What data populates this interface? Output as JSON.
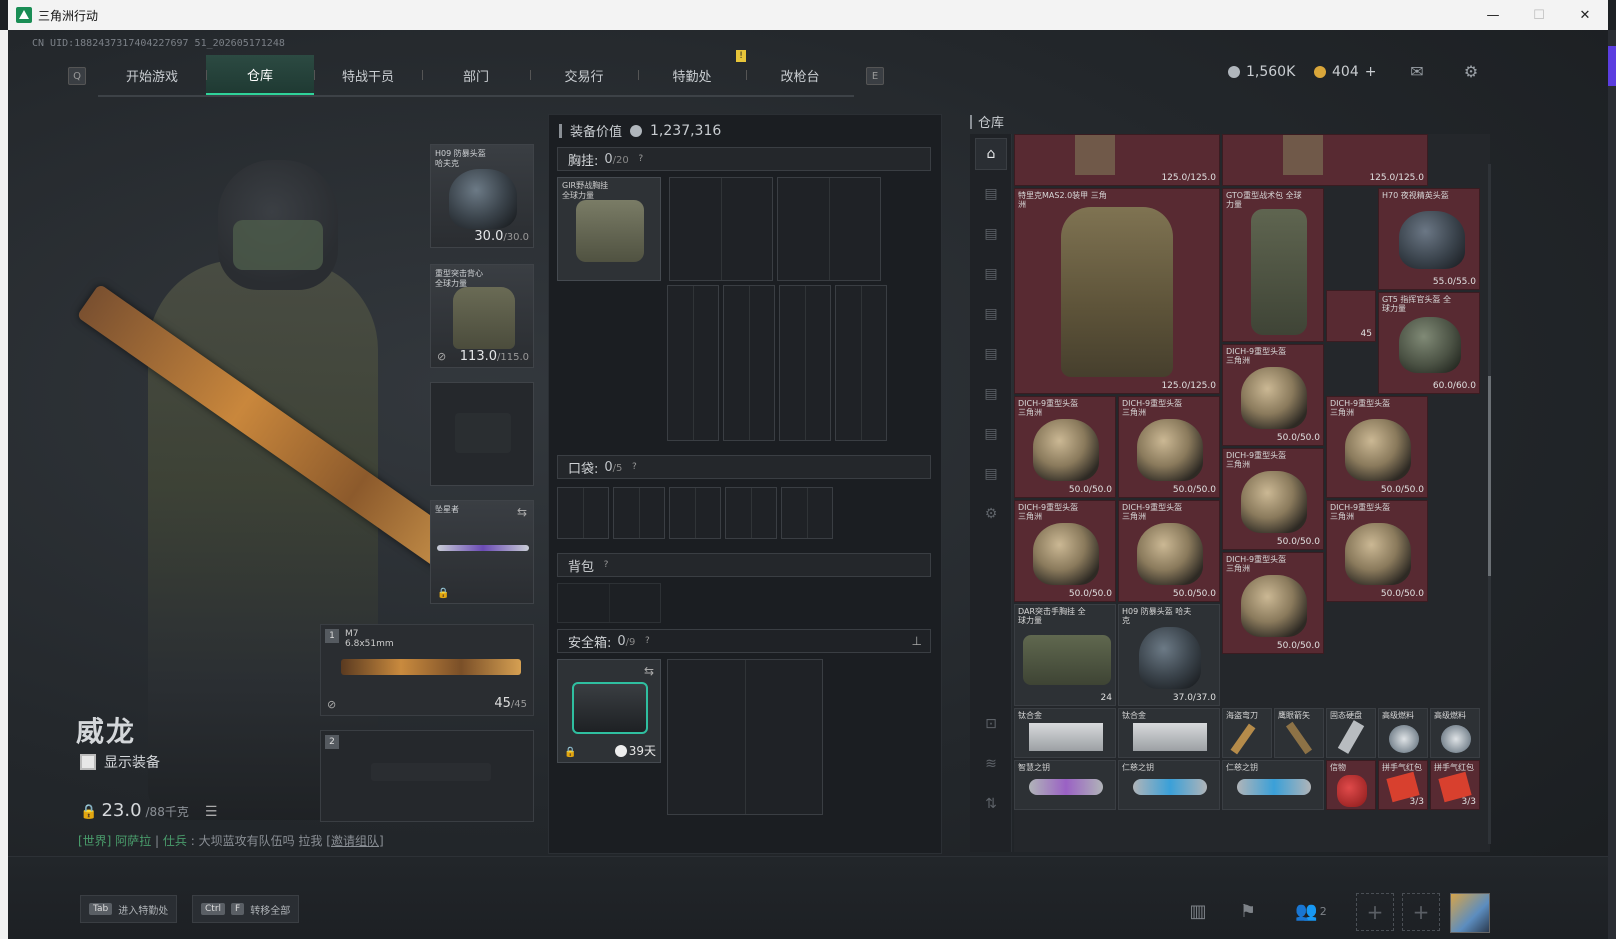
{
  "window": {
    "title": "三角洲行动",
    "min_label": "—",
    "max_label": "☐",
    "close_label": "✕"
  },
  "uid": "CN UID:1882437317404227697 51_202605171248",
  "nav": {
    "left_key": "Q",
    "right_key": "E",
    "tabs": [
      {
        "label": "开始游戏"
      },
      {
        "label": "仓库"
      },
      {
        "label": "特战干员"
      },
      {
        "label": "部门"
      },
      {
        "label": "交易行"
      },
      {
        "label": "特勤处"
      },
      {
        "label": "改枪台"
      }
    ],
    "active_tab": "仓库",
    "notice_badge": "!"
  },
  "currency": {
    "coins": "1,560K",
    "premium": "404",
    "add_label": "+"
  },
  "player": {
    "name": "威龙",
    "show_gear_label": "显示装备",
    "weight_value": "23.0",
    "weight_max": "/88千克"
  },
  "chat": {
    "channel": "[世界]",
    "sender": "阿萨拉",
    "role": "仕兵",
    "message": "大坝蓝攻有队伍吗  拉我",
    "link": "[邀请组队]"
  },
  "equipment": {
    "helmet": {
      "name": "H09 防暴头盔",
      "maker": "哈夫克",
      "durability": "30.0",
      "max": "/30.0"
    },
    "armor": {
      "name": "重型突击背心",
      "maker": "全球力量",
      "durability": "113.0",
      "max": "/115.0"
    },
    "melee": {
      "name": "坠星者"
    },
    "primary": {
      "slot": "1",
      "name": "M7",
      "caliber": "6.8x51mm",
      "ammo": "45",
      "ammo_max": "/45"
    },
    "secondary": {
      "slot": "2"
    }
  },
  "mid": {
    "equip_value_label": "装备价值",
    "equip_value": "1,237,316",
    "rig": {
      "label": "胸挂:",
      "count": "0",
      "cap": "/20",
      "item_name": "GIR野战胸挂",
      "item_maker": "全球力量"
    },
    "pocket": {
      "label": "口袋:",
      "count": "0",
      "cap": "/5"
    },
    "backpack": {
      "label": "背包"
    },
    "safebox": {
      "label": "安全箱:",
      "count": "0",
      "cap": "/9",
      "timer": "39天"
    },
    "help": "?",
    "pin": "📌"
  },
  "warehouse": {
    "title": "仓库",
    "items": [
      {
        "label": "",
        "dur": "125.0/125.0"
      },
      {
        "label": "",
        "dur": "125.0/125.0"
      },
      {
        "label": "特里克MAS2.0装甲 三角洲",
        "dur": "125.0/125.0"
      },
      {
        "label": "GTO重型战术包 全球力量",
        "dur": ""
      },
      {
        "label": "H70 夜视精英头盔",
        "dur": "55.0/55.0"
      },
      {
        "label": "GT5 指挥官头盔 全球力量",
        "dur": "60.0/60.0"
      },
      {
        "label": "DICH-9重型头盔 三角洲",
        "dur": "50.0/50.0"
      },
      {
        "label": "DICH-9重型头盔 三角洲",
        "dur": "50.0/50.0"
      },
      {
        "label": "DICH-9重型头盔 三角洲",
        "dur": "50.0/50.0"
      },
      {
        "label": "DICH-9重型头盔 三角洲",
        "dur": "50.0/50.0"
      },
      {
        "label": "DICH-9重型头盔 三角洲",
        "dur": "50.0/50.0"
      },
      {
        "label": "DICH-9重型头盔 三角洲",
        "dur": "50.0/50.0"
      },
      {
        "label": "DICH-9重型头盔 三角洲",
        "dur": "50.0/50.0"
      },
      {
        "label": "DICH-9重型头盔 三角洲",
        "dur": "50.0/50.0"
      },
      {
        "label": "DICH-9重型头盔 三角洲",
        "dur": "50.0/50.0"
      },
      {
        "label": "DAR突击手胸挂 全球力量",
        "dur": "24"
      },
      {
        "label": "H09 防暴头盔 哈夫克",
        "dur": "37.0/37.0"
      },
      {
        "label": "钛合金",
        "dur": ""
      },
      {
        "label": "钛合金",
        "dur": ""
      },
      {
        "label": "海盗弯刀",
        "dur": ""
      },
      {
        "label": "鹰眼箭矢",
        "dur": ""
      },
      {
        "label": "固态硬盘",
        "dur": ""
      },
      {
        "label": "高级燃料",
        "dur": ""
      },
      {
        "label": "高级燃料",
        "dur": ""
      },
      {
        "label": "智慧之钥",
        "dur": ""
      },
      {
        "label": "仁慈之钥",
        "dur": ""
      },
      {
        "label": "仁慈之钥",
        "dur": ""
      },
      {
        "label": "信物",
        "dur": ""
      },
      {
        "label": "拼手气红包",
        "dur": "3/3"
      },
      {
        "label": "拼手气红包",
        "dur": "3/3"
      }
    ],
    "bag_count": "45"
  },
  "bottom": {
    "hint1_key": "Tab",
    "hint1_label": "进入特勤处",
    "hint2_key1": "Ctrl",
    "hint2_key2": "F",
    "hint2_label": "转移全部",
    "team_count": "2",
    "add_label": "+"
  },
  "colors": {
    "accent": "#2fd39a",
    "rarity_red": "#582a32"
  }
}
